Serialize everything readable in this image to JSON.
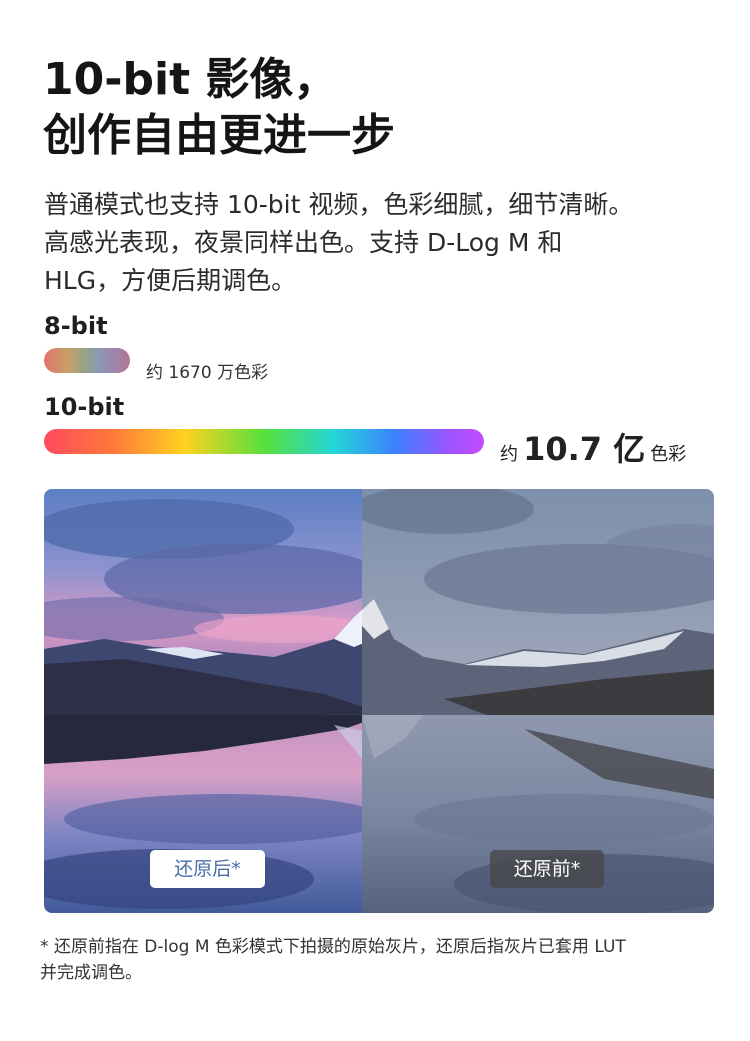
{
  "heading": {
    "line1": "10-bit 影像，",
    "line2": "创作自由更进一步"
  },
  "description": {
    "line1": "普通模式也支持 10-bit 视频，色彩细腻，细节清晰。",
    "line2": "高感光表现，夜景同样出色。支持 D-Log M 和",
    "line3": "HLG，方便后期调色。"
  },
  "comparison": {
    "eight_bit": {
      "label": "8-bit",
      "caption": "约 1670 万色彩"
    },
    "ten_bit": {
      "label": "10-bit",
      "caption_prefix": "约",
      "caption_value": "10.7 亿",
      "caption_suffix": "色彩"
    }
  },
  "photo": {
    "after_label": "还原后*",
    "before_label": "还原前*"
  },
  "footnote": {
    "line1": "* 还原前指在 D-log M 色彩模式下拍摄的原始灰片，还原后指灰片已套用 LUT",
    "line2": "并完成调色。"
  },
  "colors": {
    "after_label_text": "#4a6ea6",
    "before_label_bg": "#464648"
  }
}
